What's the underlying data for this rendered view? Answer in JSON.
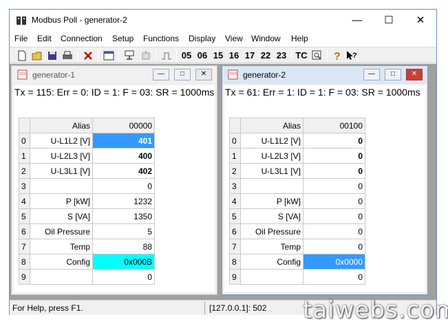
{
  "window": {
    "title": "Modbus Poll - generator-2",
    "minimize": "—",
    "maximize": "☐",
    "close": "✕"
  },
  "menu": [
    "File",
    "Edit",
    "Connection",
    "Setup",
    "Functions",
    "Display",
    "View",
    "Window",
    "Help"
  ],
  "toolbar": {
    "function_codes": [
      "05",
      "06",
      "15",
      "16",
      "17",
      "22",
      "23"
    ],
    "tc_label": "TC",
    "icons": [
      "new-icon",
      "open-icon",
      "save-icon",
      "print-icon",
      "delete-icon",
      "window-icon",
      "connect-icon",
      "disconnect-icon",
      "pulse-icon",
      "traffic-icon",
      "help-icon",
      "whats-this-icon"
    ]
  },
  "children": [
    {
      "name": "generator-1",
      "status": "Tx = 115: Err = 0: ID = 1: F = 03: SR = 1000ms",
      "header_alias": "Alias",
      "header_value": "00000",
      "rows": [
        {
          "num": "0",
          "alias": "U-L1L2 [V]",
          "value": "401"
        },
        {
          "num": "1",
          "alias": "U-L2L3 [V]",
          "value": "400"
        },
        {
          "num": "2",
          "alias": "U-L3L1 [V]",
          "value": "402"
        },
        {
          "num": "3",
          "alias": "",
          "value": "0"
        },
        {
          "num": "4",
          "alias": "P [kW]",
          "value": "1232"
        },
        {
          "num": "5",
          "alias": "S [VA]",
          "value": "1350"
        },
        {
          "num": "6",
          "alias": "Oil Pressure",
          "value": "5"
        },
        {
          "num": "7",
          "alias": "Temp",
          "value": "88"
        },
        {
          "num": "8",
          "alias": "Config",
          "value": "0x000B"
        },
        {
          "num": "9",
          "alias": "",
          "value": "0"
        }
      ]
    },
    {
      "name": "generator-2",
      "status": "Tx = 61: Err = 1: ID = 1: F = 03: SR = 1000ms",
      "header_alias": "Alias",
      "header_value": "00100",
      "rows": [
        {
          "num": "0",
          "alias": "U-L1L2 [V]",
          "value": "0"
        },
        {
          "num": "1",
          "alias": "U-L2L3 [V]",
          "value": "0"
        },
        {
          "num": "2",
          "alias": "U-L3L1 [V]",
          "value": "0"
        },
        {
          "num": "3",
          "alias": "",
          "value": "0"
        },
        {
          "num": "4",
          "alias": "P [kW]",
          "value": "0"
        },
        {
          "num": "5",
          "alias": "S [VA]",
          "value": "0"
        },
        {
          "num": "6",
          "alias": "Oil Pressure",
          "value": "0"
        },
        {
          "num": "7",
          "alias": "Temp",
          "value": "0"
        },
        {
          "num": "8",
          "alias": "Config",
          "value": "0x0000"
        },
        {
          "num": "9",
          "alias": "",
          "value": "0"
        }
      ]
    }
  ],
  "statusbar": {
    "help": "For Help, press F1.",
    "address": "[127.0.0.1]: 502"
  },
  "watermark": "taiwebs.com",
  "colors": {
    "highlight_blue": "#3399ff",
    "highlight_cyan": "#00ffff",
    "active_title": "#dae7f5",
    "mdi_background": "#a0a0a0"
  }
}
